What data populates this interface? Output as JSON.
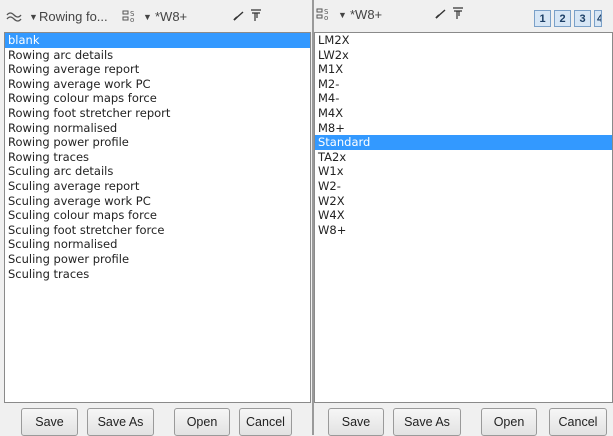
{
  "left": {
    "toolbar": {
      "preset_label": "Rowing fo...",
      "boat_label": "*W8+",
      "icons": [
        "rowing-icon",
        "dropdown-arrow-icon",
        "table-grid-icon",
        "dropdown-arrow-icon",
        "checkmark-icon",
        "filter-icon"
      ]
    },
    "items": [
      "blank",
      "Rowing arc details",
      "Rowing average report",
      "Rowing average work PC",
      "Rowing colour maps force",
      "Rowing foot stretcher report",
      "Rowing normalised",
      "Rowing power profile",
      "Rowing traces",
      "Sculing arc details",
      "Sculing average report",
      "Sculing average work PC",
      "Sculing colour maps force",
      "Sculing foot stretcher force",
      "Sculing normalised",
      "Sculing power profile",
      "Sculing traces"
    ],
    "selected_index": 0,
    "buttons": {
      "save": "Save",
      "save_as": "Save As",
      "open": "Open",
      "cancel": "Cancel"
    }
  },
  "right": {
    "toolbar": {
      "boat_label": "*W8+",
      "pages": [
        "1",
        "2",
        "3",
        "4"
      ],
      "icons": [
        "table-grid-icon",
        "dropdown-arrow-icon",
        "checkmark-icon",
        "filter-icon"
      ]
    },
    "items": [
      "LM2X",
      "LW2x",
      "M1X",
      "M2-",
      "M4-",
      "M4X",
      "M8+",
      "Standard",
      "TA2x",
      "W1x",
      "W2-",
      "W2X",
      "W4X",
      "W8+"
    ],
    "selected_index": 7,
    "buttons": {
      "save": "Save",
      "save_as": "Save As",
      "open": "Open",
      "cancel": "Cancel"
    }
  },
  "colors": {
    "selection": "#3399ff",
    "page_button": "#d7e6f5"
  }
}
